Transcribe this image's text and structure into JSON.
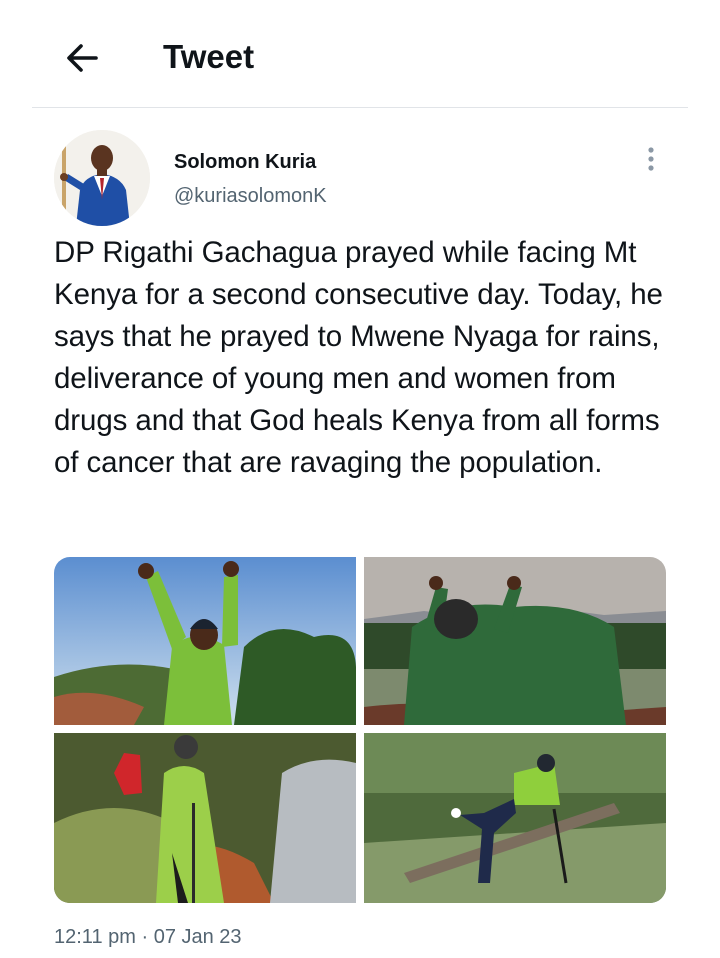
{
  "header": {
    "title": "Tweet",
    "back_icon": "arrow-left-icon"
  },
  "tweet": {
    "author_name": "Solomon Kuria",
    "author_handle": "@kuriasolomonK",
    "text": "DP Rigathi Gachagua prayed while facing Mt Kenya for a second consecutive day. Today, he says that he prayed to Mwene Nyaga for rains, deliverance of young men and women from drugs and that God heals Kenya from all forms of cancer that are ravaging the population.",
    "time": "12:11 pm",
    "separator": "·",
    "date": "07 Jan 23",
    "media_count": 4
  },
  "colors": {
    "text": "#0f1419",
    "secondary": "#536471",
    "divider": "#e1e4e8"
  }
}
